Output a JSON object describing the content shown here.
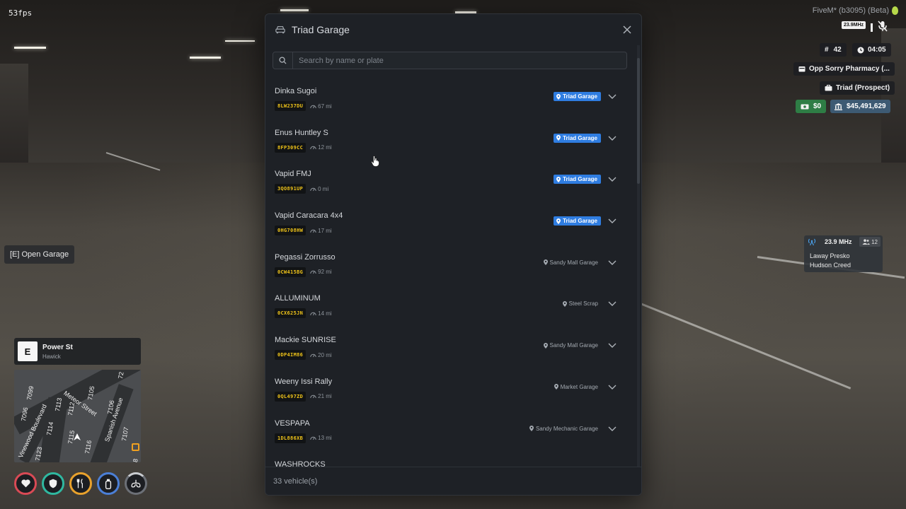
{
  "hud": {
    "fps": "53fps",
    "client_version": "FiveM* (b3095) (Beta)",
    "radio_small": "23.9MHz",
    "player_id": "42",
    "clock": "04:05",
    "location_label": "Opp Sorry Pharmacy (...",
    "gang_label": "Triad (Prospect)",
    "cash": "$0",
    "bank": "$45,491,629"
  },
  "prompt": {
    "open_garage": "[E] Open Garage"
  },
  "street": {
    "compass": "E",
    "name": "Power St",
    "area": "Hawick"
  },
  "minimap": {
    "labels": [
      "Vinewood Boulevard",
      "Meteor Street",
      "Spanish Avenue",
      "7099",
      "7096",
      "7113",
      "7112",
      "7105",
      "7106",
      "7107",
      "7114",
      "7115",
      "7116",
      "7123",
      "72",
      "8"
    ]
  },
  "radio": {
    "frequency": "23.9 MHz",
    "member_count": "12",
    "members": [
      "Laway Presko",
      "Hudson Creed"
    ]
  },
  "garage": {
    "title": "Triad Garage",
    "search_placeholder": "Search by name or plate",
    "footer": "33 vehicle(s)",
    "vehicles": [
      {
        "name": "Dinka Sugoi",
        "plate": "8LW237DU",
        "mileage": "67 mi",
        "garage": "Triad Garage",
        "highlight": true
      },
      {
        "name": "Enus Huntley S",
        "plate": "8FP309CC",
        "mileage": "12 mi",
        "garage": "Triad Garage",
        "highlight": true
      },
      {
        "name": "Vapid FMJ",
        "plate": "3QO891UP",
        "mileage": "0 mi",
        "garage": "Triad Garage",
        "highlight": true
      },
      {
        "name": "Vapid Caracara 4x4",
        "plate": "0HG708HW",
        "mileage": "17 mi",
        "garage": "Triad Garage",
        "highlight": true
      },
      {
        "name": "Pegassi Zorrusso",
        "plate": "0CW415BG",
        "mileage": "92 mi",
        "garage": "Sandy Mall Garage",
        "highlight": false
      },
      {
        "name": "ALLUMINUM",
        "plate": "0CX625JN",
        "mileage": "14 mi",
        "garage": "Steel Scrap",
        "highlight": false
      },
      {
        "name": "Mackie SUNRISE",
        "plate": "0DP4IM86",
        "mileage": "20 mi",
        "garage": "Sandy Mall Garage",
        "highlight": false
      },
      {
        "name": "Weeny Issi Rally",
        "plate": "0QL497ZD",
        "mileage": "21 mi",
        "garage": "Market Garage",
        "highlight": false
      },
      {
        "name": "VESPAPA",
        "plate": "1DL886XB",
        "mileage": "13 mi",
        "garage": "Sandy Mechanic Garage",
        "highlight": false
      },
      {
        "name": "WASHROCKS",
        "plate": "",
        "mileage": "",
        "garage": "",
        "highlight": false
      }
    ]
  }
}
